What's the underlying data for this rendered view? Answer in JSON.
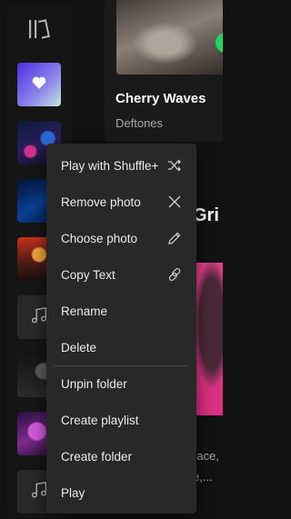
{
  "album_card": {
    "title": "Cherry Waves",
    "artist": "Deftones"
  },
  "section": {
    "title_fragment": "Gri"
  },
  "description_fragments": [
    "race,",
    "e,..."
  ],
  "context_menu": {
    "items": [
      {
        "label": "Play with Shuffle+",
        "icon": "shuffle-icon"
      },
      {
        "label": "Remove photo",
        "icon": "close-icon"
      },
      {
        "label": "Choose photo",
        "icon": "pencil-icon"
      },
      {
        "label": "Copy Text",
        "icon": "link-icon"
      },
      {
        "label": "Rename"
      },
      {
        "label": "Delete"
      },
      {
        "label": "Unpin folder"
      },
      {
        "label": "Create playlist"
      },
      {
        "label": "Create folder"
      },
      {
        "label": "Play"
      }
    ]
  },
  "colors": {
    "background": "#121212",
    "menu_background": "#282828",
    "accent_green": "#1ed760"
  }
}
